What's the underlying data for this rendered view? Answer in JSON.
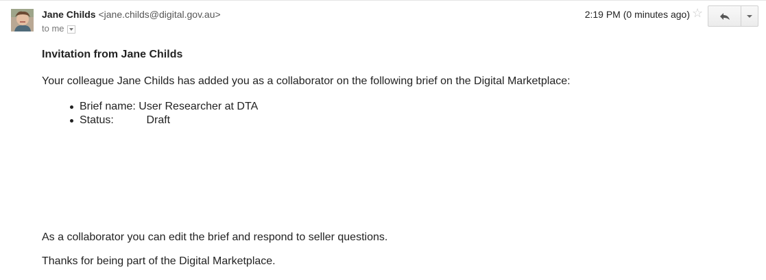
{
  "email": {
    "sender_name": "Jane Childs",
    "sender_email": "<jane.childs@digital.gov.au>",
    "recipient": "to me",
    "timestamp": "2:19 PM (0 minutes ago)",
    "star_icon": "star-outline-icon",
    "reply_icon": "reply-arrow-icon",
    "more_icon": "chevron-down-icon"
  },
  "message": {
    "subject": "Invitation from Jane Childs",
    "intro": "Your colleague Jane Childs has added you as a collaborator on the following brief on the Digital Marketplace:",
    "details": [
      {
        "label": "Brief name:",
        "value": "User Researcher at DTA"
      },
      {
        "label": "Status:",
        "value": "Draft"
      }
    ],
    "paragraph_1": "As a collaborator you can edit the brief and respond to seller questions.",
    "paragraph_2": "Thanks for being part of the Digital Marketplace."
  },
  "colors": {
    "text": "#222222",
    "muted": "#777777",
    "star": "#c8c8c8",
    "button_border": "#d0d0d0"
  }
}
